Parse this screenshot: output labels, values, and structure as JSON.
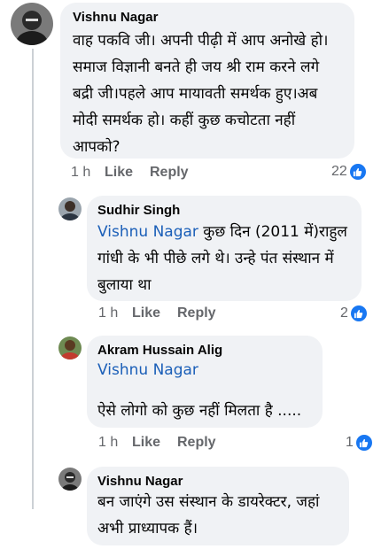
{
  "comments": [
    {
      "author": "Vishnu Nagar",
      "text": "वाह पकवि जी। अपनी पीढ़ी में आप अनोखे हो। समाज विज्ञानी बनते ही जय श्री राम करने लगे बद्री जी।पहले आप मायावती समर्थक हुए।अब मोदी समर्थक हो। कहीं कुछ कचोटता नहीं आपको?",
      "time": "1 h",
      "like_label": "Like",
      "reply_label": "Reply",
      "reaction_count": "22"
    },
    {
      "author": "Sudhir Singh",
      "mention": "Vishnu Nagar",
      "text": " कुछ दिन (2011 में)राहुल गांधी के भी पीछे लगे थे। उन्हे पंत संस्थान में बुलाया था",
      "time": "1 h",
      "like_label": "Like",
      "reply_label": "Reply",
      "reaction_count": "2"
    },
    {
      "author": "Akram Hussain Alig",
      "mention": "Vishnu Nagar",
      "text": "ऐसे लोगो को कुछ नहीं मिलता है .....",
      "time": "1 h",
      "like_label": "Like",
      "reply_label": "Reply",
      "reaction_count": "1"
    },
    {
      "author": "Vishnu Nagar",
      "text": "बन जाएंगे उस संस्थान के डायरेक्टर, जहां अभी प्राध्यापक हैं।"
    }
  ],
  "colors": {
    "bubble": "#f0f2f5",
    "mention": "#1b5fb8",
    "meta": "#65676b",
    "like": "#1877f2"
  }
}
